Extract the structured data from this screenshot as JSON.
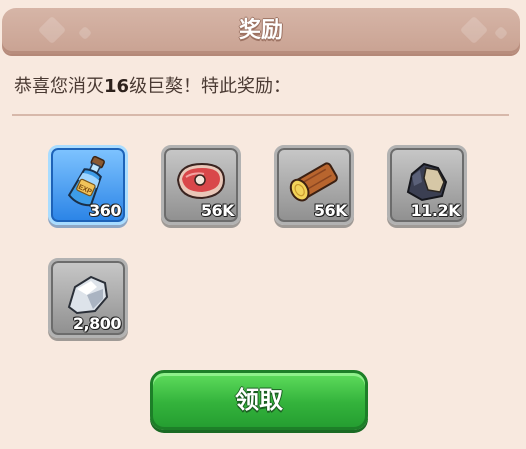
{
  "header": {
    "title": "奖励"
  },
  "message": {
    "prefix": "恭喜您消灭",
    "level": "16",
    "suffix": "级巨獒！特此奖励："
  },
  "rewards": [
    {
      "icon": "exp-potion-icon",
      "quantity": "360",
      "frame": "blue"
    },
    {
      "icon": "meat-icon",
      "quantity": "56K",
      "frame": "gray"
    },
    {
      "icon": "wood-log-icon",
      "quantity": "56K",
      "frame": "gray"
    },
    {
      "icon": "coal-ore-icon",
      "quantity": "11.2K",
      "frame": "gray"
    },
    {
      "icon": "stone-icon",
      "quantity": "2,800",
      "frame": "gray"
    }
  ],
  "claim_button": {
    "label": "领取"
  },
  "colors": {
    "panel": "#f8e9df",
    "header": "#d0ac9c",
    "button": "#34b33c",
    "highlight": "#2a83e6"
  }
}
